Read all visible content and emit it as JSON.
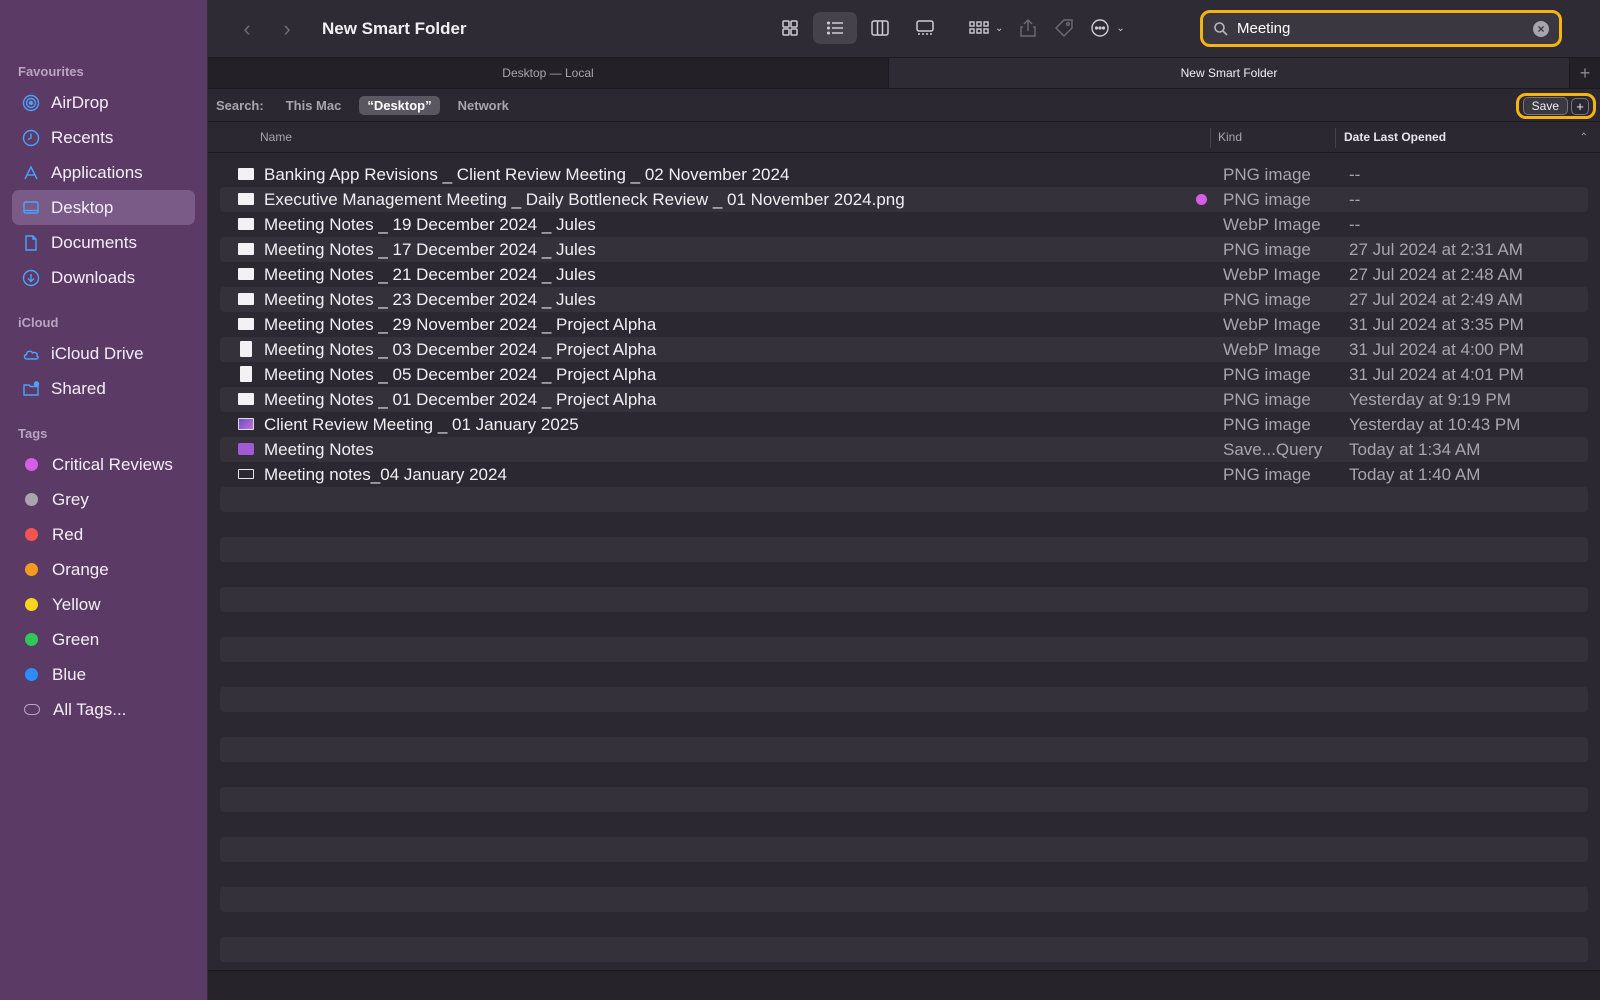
{
  "window": {
    "title": "New Smart Folder"
  },
  "sidebar": {
    "sections": [
      {
        "title": "Favourites",
        "items": [
          {
            "label": "AirDrop",
            "icon": "airdrop-icon"
          },
          {
            "label": "Recents",
            "icon": "clock-icon"
          },
          {
            "label": "Applications",
            "icon": "applications-icon"
          },
          {
            "label": "Desktop",
            "icon": "desktop-icon",
            "active": true
          },
          {
            "label": "Documents",
            "icon": "document-icon"
          },
          {
            "label": "Downloads",
            "icon": "download-icon"
          }
        ]
      },
      {
        "title": "iCloud",
        "items": [
          {
            "label": "iCloud Drive",
            "icon": "cloud-icon"
          },
          {
            "label": "Shared",
            "icon": "shared-folder-icon"
          }
        ]
      },
      {
        "title": "Tags",
        "items": [
          {
            "label": "Critical Reviews",
            "color": "#d65de8"
          },
          {
            "label": "Grey",
            "color": "#a9a4ad"
          },
          {
            "label": "Red",
            "color": "#f2544e"
          },
          {
            "label": "Orange",
            "color": "#f79a1d"
          },
          {
            "label": "Yellow",
            "color": "#f7d51d"
          },
          {
            "label": "Green",
            "color": "#30c85a"
          },
          {
            "label": "Blue",
            "color": "#2d8cf7"
          },
          {
            "label": "All Tags...",
            "color": "outline"
          }
        ]
      }
    ]
  },
  "search": {
    "value": "Meeting",
    "placeholder": "Search"
  },
  "tabs": [
    {
      "label": "Desktop — Local",
      "active": false
    },
    {
      "label": "New Smart Folder",
      "active": true
    }
  ],
  "scope": {
    "label": "Search:",
    "options": [
      "This Mac",
      "“Desktop”",
      "Network"
    ],
    "active_index": 1,
    "save_label": "Save",
    "plus_label": "+"
  },
  "columns": {
    "name": "Name",
    "kind": "Kind",
    "date": "Date Last Opened"
  },
  "files": [
    {
      "name": "Banking App Revisions _ Client Review Meeting _ 02 November 2024",
      "kind": "PNG image",
      "date": "--",
      "icon": "image-icon"
    },
    {
      "name": "Executive Management Meeting _ Daily Bottleneck Review _ 01 November 2024.png",
      "kind": "PNG image",
      "date": "--",
      "icon": "image-icon",
      "tag": "#d65de8"
    },
    {
      "name": "Meeting Notes _ 19 December 2024 _ Jules",
      "kind": "WebP Image",
      "date": "--",
      "icon": "image-icon"
    },
    {
      "name": "Meeting Notes _ 17 December 2024 _ Jules",
      "kind": "PNG image",
      "date": "27 Jul 2024 at 2:31 AM",
      "icon": "image-icon"
    },
    {
      "name": "Meeting Notes _ 21 December 2024 _ Jules",
      "kind": "WebP Image",
      "date": "27 Jul 2024 at 2:48 AM",
      "icon": "image-icon"
    },
    {
      "name": "Meeting Notes _ 23 December 2024 _ Jules",
      "kind": "PNG image",
      "date": "27 Jul 2024 at 2:49 AM",
      "icon": "image-icon"
    },
    {
      "name": "Meeting Notes _ 29 November 2024 _ Project Alpha",
      "kind": "WebP Image",
      "date": "31 Jul 2024 at 3:35 PM",
      "icon": "image-icon"
    },
    {
      "name": "Meeting Notes _ 03 December 2024 _ Project Alpha",
      "kind": "WebP Image",
      "date": "31 Jul 2024 at 4:00 PM",
      "icon": "document-icon"
    },
    {
      "name": "Meeting Notes _ 05 December 2024 _ Project Alpha",
      "kind": "PNG image",
      "date": "31 Jul 2024 at 4:01 PM",
      "icon": "document-icon"
    },
    {
      "name": "Meeting Notes _ 01 December 2024 _ Project Alpha",
      "kind": "PNG image",
      "date": "Yesterday at 9:19 PM",
      "icon": "image-icon"
    },
    {
      "name": "Client Review Meeting _ 01 January 2025",
      "kind": "PNG image",
      "date": "Yesterday at 10:43 PM",
      "icon": "photo-icon"
    },
    {
      "name": "Meeting Notes",
      "kind": "Save...Query",
      "date": "Today at 1:34 AM",
      "icon": "smart-folder-icon"
    },
    {
      "name": "Meeting notes_04 January 2024",
      "kind": "PNG image",
      "date": "Today at 1:40 AM",
      "icon": "outline-image-icon"
    }
  ],
  "empty_rows": 19
}
